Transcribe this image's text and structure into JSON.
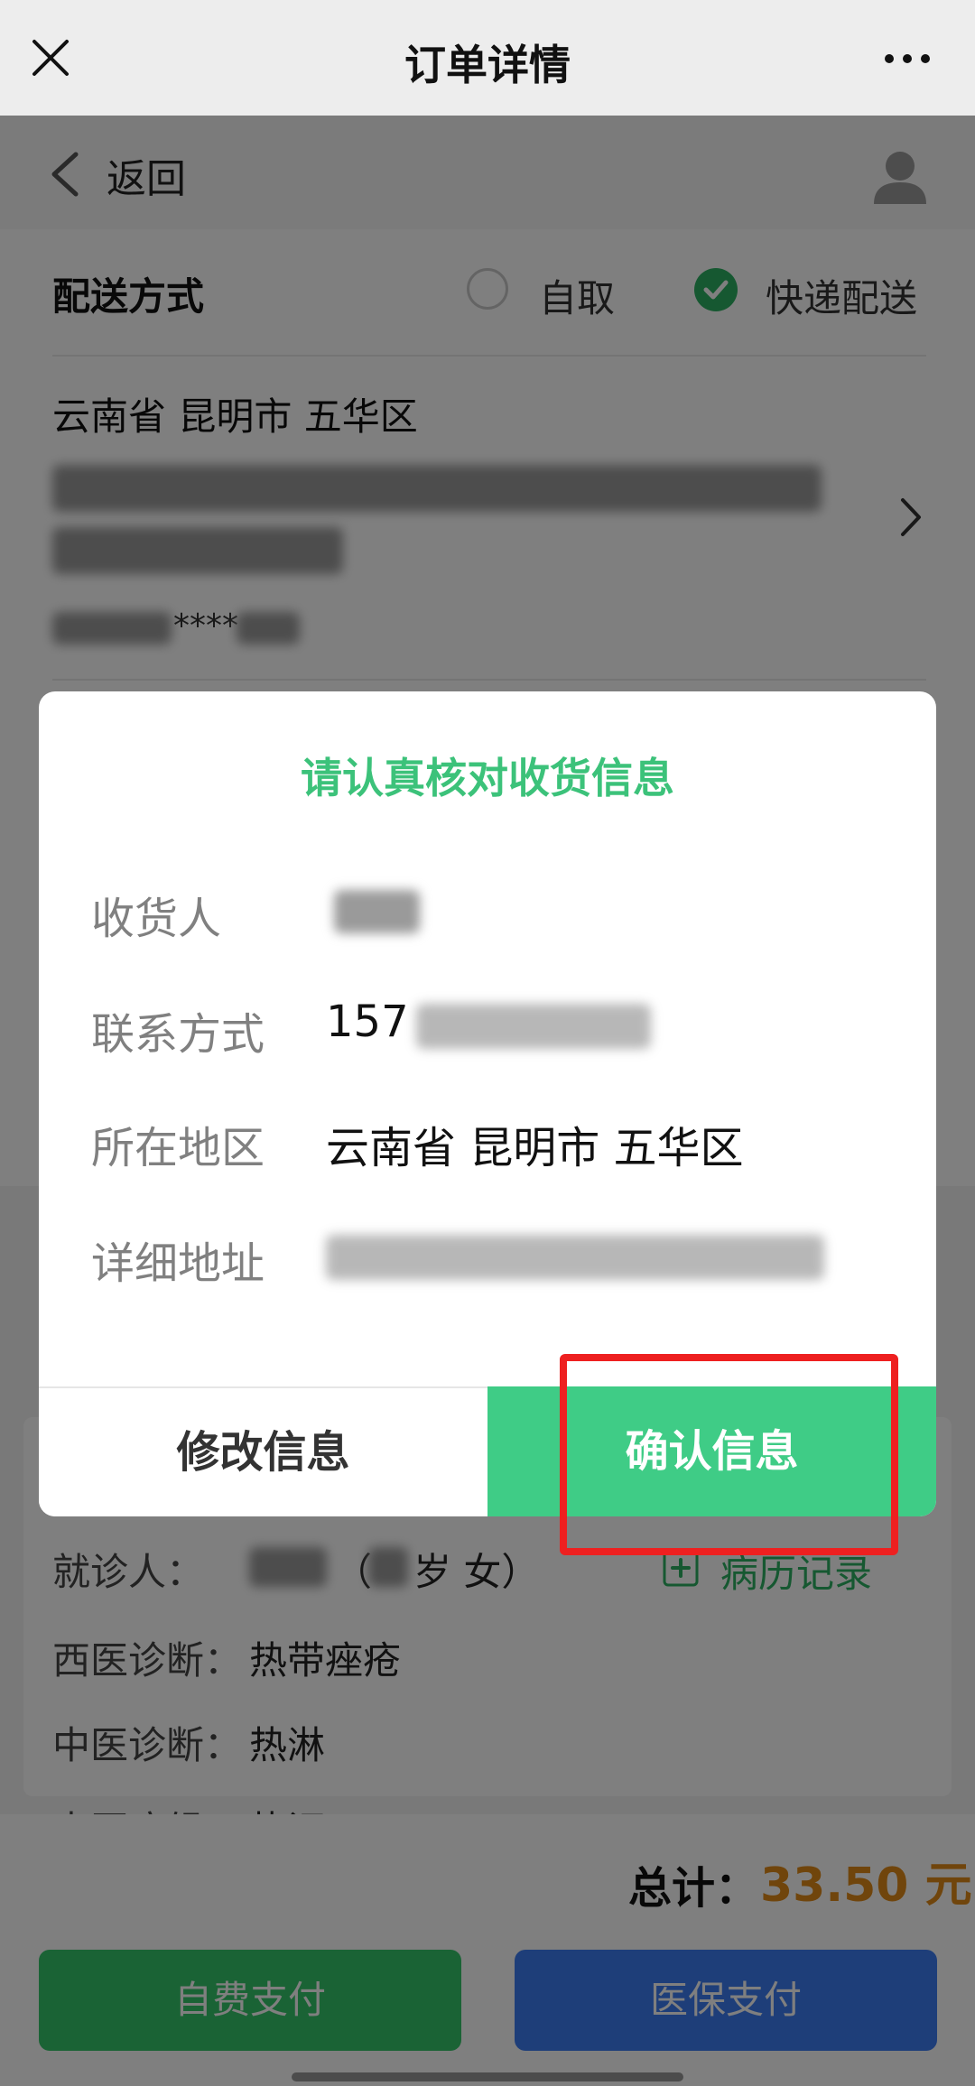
{
  "top_bar": {
    "title": "订单详情"
  },
  "nav": {
    "back_label": "返回"
  },
  "delivery": {
    "label": "配送方式",
    "option_pickup": "自取",
    "option_express": "快递配送",
    "selected": "快递配送"
  },
  "address": {
    "region": "云南省 昆明市 五华区",
    "phone_masked": "****"
  },
  "dialog": {
    "title": "请认真核对收货信息",
    "rows": [
      {
        "label": "收货人",
        "value": ""
      },
      {
        "label": "联系方式",
        "value": "157"
      },
      {
        "label": "所在地区",
        "value": "云南省 昆明市 五华区"
      },
      {
        "label": "详细地址",
        "value": ""
      }
    ],
    "modify_button": "修改信息",
    "confirm_button": "确认信息"
  },
  "patient": {
    "patient_label": "就诊人：",
    "patient_value_suffix": "（",
    "patient_age_suffix": "岁 女）",
    "records_button": "病历记录",
    "western_label": "西医诊断：",
    "western_value": "热带痤疮",
    "tcm_label": "中医诊断：",
    "tcm_value": "热淋",
    "syndrome_label": "中医症候：",
    "syndrome_value": "热证"
  },
  "bottom": {
    "total_label": "总计：",
    "total_value": "33.50 元",
    "pay_self": "自费支付",
    "pay_insurance": "医保支付"
  },
  "colors": {
    "accent_green": "#3fcc86",
    "title_green": "#3cc27a",
    "price_orange": "#e08a18",
    "insurance_blue": "#3d7df2",
    "highlight_red": "#ee2020"
  }
}
